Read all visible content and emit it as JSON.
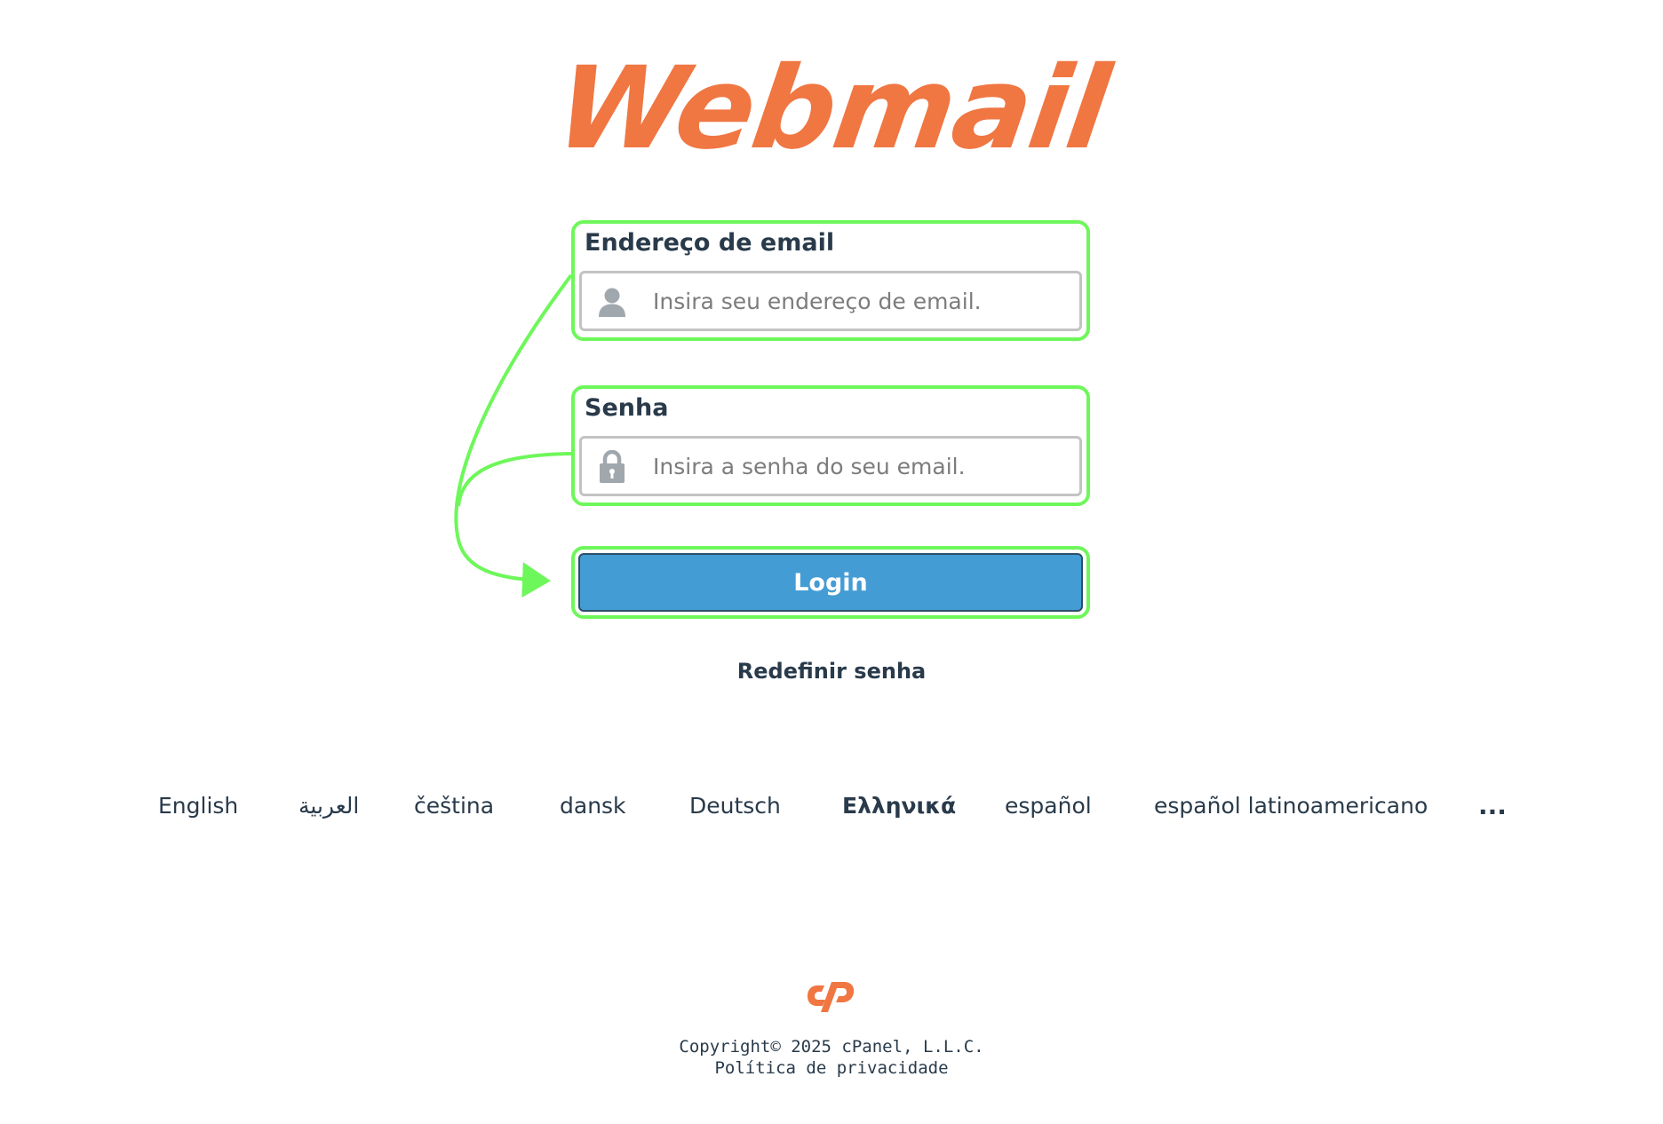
{
  "logo": {
    "text": "Webmail",
    "color": "#f07642"
  },
  "form": {
    "email": {
      "label": "Endereço de email",
      "placeholder": "Insira seu endereço de email.",
      "icon": "user-icon"
    },
    "password": {
      "label": "Senha",
      "placeholder": "Insira a senha do seu email.",
      "icon": "lock-icon"
    },
    "login_label": "Login",
    "reset_label": "Redefinir senha"
  },
  "languages": {
    "items": [
      "English",
      "العربية",
      "čeština",
      "dansk",
      "Deutsch",
      "Ελληνικά",
      "español",
      "español latinoamericano"
    ],
    "more_label": "..."
  },
  "footer": {
    "copyright": "Copyright© 2025 cPanel, L.L.C.",
    "privacy": "Política de privacidade"
  },
  "colors": {
    "brand_orange": "#f07642",
    "button_blue": "#449cd4",
    "highlight_green": "#6ef75a",
    "text_dark": "#293a4a"
  }
}
